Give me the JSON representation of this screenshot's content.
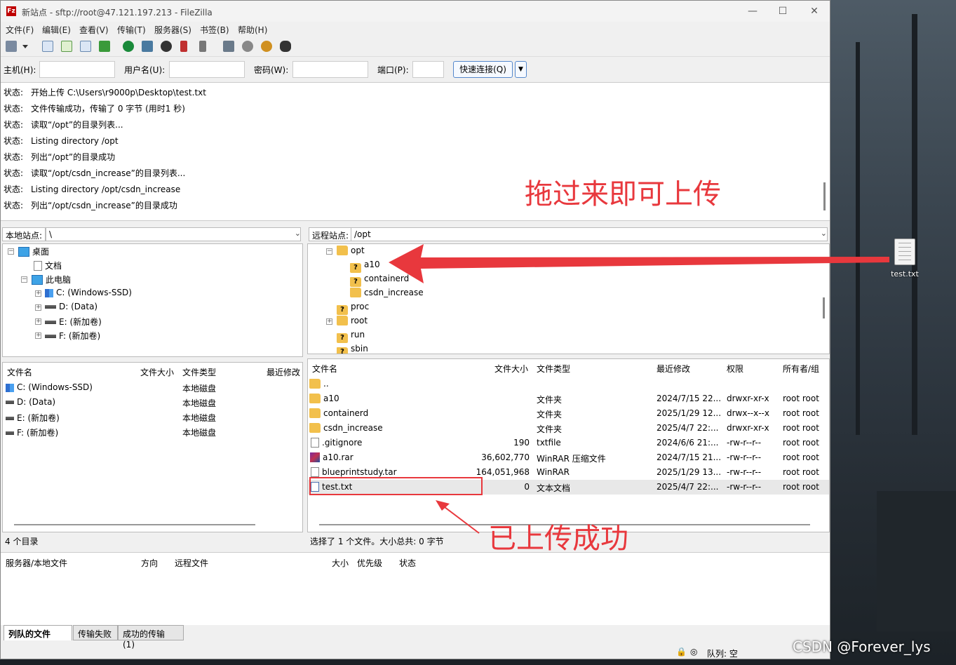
{
  "window": {
    "title": "新站点 - sftp://root@47.121.197.213 - FileZilla",
    "minimize": "—",
    "maximize": "☐",
    "close": "✕"
  },
  "menu": [
    "文件(F)",
    "编辑(E)",
    "查看(V)",
    "传输(T)",
    "服务器(S)",
    "书签(B)",
    "帮助(H)"
  ],
  "quickconnect": {
    "host_label": "主机(H):",
    "user_label": "用户名(U):",
    "pass_label": "密码(W):",
    "port_label": "端口(P):",
    "button": "快速连接(Q)"
  },
  "log": [
    {
      "k": "状态:",
      "v": "开始上传 C:\\Users\\r9000p\\Desktop\\test.txt"
    },
    {
      "k": "状态:",
      "v": "文件传输成功，传输了 0 字节 (用时1 秒)"
    },
    {
      "k": "状态:",
      "v": "读取“/opt”的目录列表..."
    },
    {
      "k": "状态:",
      "v": "Listing directory /opt"
    },
    {
      "k": "状态:",
      "v": "列出“/opt”的目录成功"
    },
    {
      "k": "状态:",
      "v": "读取“/opt/csdn_increase”的目录列表..."
    },
    {
      "k": "状态:",
      "v": "Listing directory /opt/csdn_increase"
    },
    {
      "k": "状态:",
      "v": "列出“/opt/csdn_increase”的目录成功"
    }
  ],
  "local": {
    "site_label": "本地站点:",
    "path": "\\",
    "tree": [
      {
        "label": "桌面",
        "icon": "desktop-icon"
      },
      {
        "label": "文档",
        "icon": "document-icon"
      },
      {
        "label": "此电脑",
        "icon": "computer-icon"
      },
      {
        "label": "C: (Windows-SSD)",
        "icon": "windows-drive-icon"
      },
      {
        "label": "D: (Data)",
        "icon": "drive-icon"
      },
      {
        "label": "E: (新加卷)",
        "icon": "drive-icon"
      },
      {
        "label": "F: (新加卷)",
        "icon": "drive-icon"
      }
    ],
    "columns": [
      "文件名",
      "文件大小",
      "文件类型",
      "最近修改"
    ],
    "files": [
      {
        "name": "C: (Windows-SSD)",
        "type": "本地磁盘"
      },
      {
        "name": "D: (Data)",
        "type": "本地磁盘"
      },
      {
        "name": "E: (新加卷)",
        "type": "本地磁盘"
      },
      {
        "name": "F: (新加卷)",
        "type": "本地磁盘"
      }
    ],
    "status": "4 个目录"
  },
  "remote": {
    "site_label": "远程站点:",
    "path": "/opt",
    "tree": [
      {
        "label": "opt"
      },
      {
        "label": "a10"
      },
      {
        "label": "containerd"
      },
      {
        "label": "csdn_increase"
      },
      {
        "label": "proc"
      },
      {
        "label": "root"
      },
      {
        "label": "run"
      },
      {
        "label": "sbin"
      }
    ],
    "columns": [
      "文件名",
      "文件大小",
      "文件类型",
      "最近修改",
      "权限",
      "所有者/组"
    ],
    "files": [
      {
        "name": "..",
        "size": "",
        "type": "",
        "modified": "",
        "perm": "",
        "owner": ""
      },
      {
        "name": "a10",
        "size": "",
        "type": "文件夹",
        "modified": "2024/7/15 22...",
        "perm": "drwxr-xr-x",
        "owner": "root root"
      },
      {
        "name": "containerd",
        "size": "",
        "type": "文件夹",
        "modified": "2025/1/29 12...",
        "perm": "drwx--x--x",
        "owner": "root root"
      },
      {
        "name": "csdn_increase",
        "size": "",
        "type": "文件夹",
        "modified": "2025/4/7 22:...",
        "perm": "drwxr-xr-x",
        "owner": "root root"
      },
      {
        "name": ".gitignore",
        "size": "190",
        "type": "txtfile",
        "modified": "2024/6/6 21:...",
        "perm": "-rw-r--r--",
        "owner": "root root"
      },
      {
        "name": "a10.rar",
        "size": "36,602,770",
        "type": "WinRAR 压缩文件",
        "modified": "2024/7/15 21...",
        "perm": "-rw-r--r--",
        "owner": "root root"
      },
      {
        "name": "blueprintstudy.tar",
        "size": "164,051,968",
        "type": "WinRAR",
        "modified": "2025/1/29 13...",
        "perm": "-rw-r--r--",
        "owner": "root root"
      },
      {
        "name": "test.txt",
        "size": "0",
        "type": "文本文档",
        "modified": "2025/4/7 22:...",
        "perm": "-rw-r--r--",
        "owner": "root root"
      }
    ],
    "status": "选择了 1 个文件。大小总共: 0 字节"
  },
  "queue": {
    "columns": [
      "服务器/本地文件",
      "方向",
      "远程文件",
      "大小",
      "优先级",
      "状态"
    ],
    "tabs": [
      "列队的文件",
      "传输失败",
      "成功的传输 (1)"
    ],
    "status": "队列: 空"
  },
  "annotations": {
    "drag": "拖过来即可上传",
    "done": "已上传成功"
  },
  "desktop": {
    "file_label": "test.txt"
  },
  "watermark": "CSDN @Forever_lys",
  "colors": {
    "annotation": "#e8383d",
    "accent": "#2e6fd0",
    "folder": "#f2c04c"
  }
}
